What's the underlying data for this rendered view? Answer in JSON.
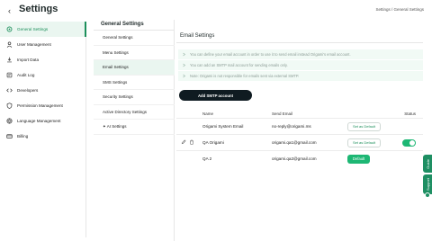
{
  "header": {
    "back_icon": "chevron-left-icon",
    "title": "Settings",
    "breadcrumb": "Settings / General Settings"
  },
  "sidebar": {
    "items": [
      {
        "label": "General Settings",
        "icon": "gear-icon",
        "active": true
      },
      {
        "label": "User Management",
        "icon": "user-icon"
      },
      {
        "label": "Import Data",
        "icon": "import-icon"
      },
      {
        "label": "Audit Log",
        "icon": "log-icon"
      },
      {
        "label": "Developers",
        "icon": "developer-icon"
      },
      {
        "label": "Permission Management",
        "icon": "shield-icon"
      },
      {
        "label": "Language Management",
        "icon": "globe-icon"
      },
      {
        "label": "Billing",
        "icon": "billing-icon"
      }
    ]
  },
  "subnav": {
    "title": "General Settings",
    "items": [
      {
        "label": "General Settings"
      },
      {
        "label": "Menu Settings"
      },
      {
        "label": "Email Settings",
        "active": true
      },
      {
        "label": "SMS Settings"
      },
      {
        "label": "Security Settings"
      },
      {
        "label": "Active Directory Settings"
      },
      {
        "label": "AI Settings",
        "icon": "sparkle-icon"
      }
    ]
  },
  "email": {
    "title": "Email Settings",
    "notes": [
      "You can define your email account in order to use it to send email instead Origami's email account.",
      "You can add an SMTP mail account for sending emails only.",
      "Note: Origami is not responsible for emails sent via external SMTP."
    ],
    "add_button": "Add SMTP account",
    "columns": {
      "name": "Name",
      "email": "Send Email",
      "status": "Status"
    },
    "rows": [
      {
        "name": "Origami System Email",
        "email": "no-reply@origami.ms",
        "default_label": "Set as Default",
        "is_default": false,
        "show_actions": false,
        "status_on": null
      },
      {
        "name": "QA Origami",
        "email": "origami.qa1@gmail.com",
        "default_label": "Set as Default",
        "is_default": false,
        "show_actions": true,
        "status_on": true
      },
      {
        "name": "QA 2",
        "email": "origami.qa2@gmail.com",
        "default_label": "Default",
        "is_default": true,
        "show_actions": false,
        "status_on": null
      }
    ]
  },
  "side_tabs": {
    "guide": "Guide",
    "support": "Support"
  },
  "colors": {
    "accent": "#1db774",
    "accent_dark": "#1c8f5b",
    "button_dark": "#0f1b21",
    "note_bg": "#f1faf5"
  }
}
